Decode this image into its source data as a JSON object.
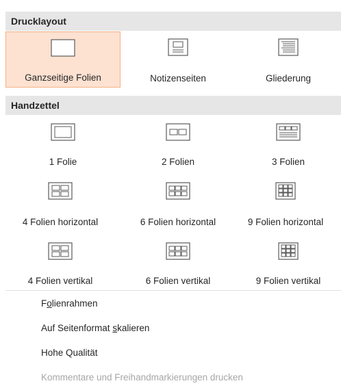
{
  "print_layout": {
    "header": "Drucklayout",
    "items": [
      {
        "label": "Ganzseitige Folien",
        "icon": "full-page-slide-icon",
        "selected": true
      },
      {
        "label": "Notizenseiten",
        "icon": "notes-page-icon",
        "selected": false
      },
      {
        "label": "Gliederung",
        "icon": "outline-icon",
        "selected": false
      }
    ]
  },
  "handouts": {
    "header": "Handzettel",
    "items": [
      {
        "label": "1 Folie",
        "icon": "handout-1-slide-icon"
      },
      {
        "label": "2 Folien",
        "icon": "handout-2-slides-icon"
      },
      {
        "label": "3 Folien",
        "icon": "handout-3-slides-icon"
      },
      {
        "label": "4 Folien horizontal",
        "icon": "handout-4-horizontal-icon"
      },
      {
        "label": "6 Folien horizontal",
        "icon": "handout-6-horizontal-icon"
      },
      {
        "label": "9 Folien horizontal",
        "icon": "handout-9-horizontal-icon"
      },
      {
        "label": "4 Folien vertikal",
        "icon": "handout-4-vertical-icon"
      },
      {
        "label": "6 Folien vertikal",
        "icon": "handout-6-vertical-icon"
      },
      {
        "label": "9 Folien vertikal",
        "icon": "handout-9-vertical-icon"
      }
    ]
  },
  "options": {
    "frame_slides_pre": "F",
    "frame_slides_underline": "o",
    "frame_slides_post": "lienrahmen",
    "scale_pre": "Auf Seitenformat ",
    "scale_underline": "s",
    "scale_post": "kalieren",
    "high_quality": "Hohe Qualität",
    "comments": "Kommentare und Freihandmarkierungen drucken"
  },
  "colors": {
    "selected_background": "#fde1d1",
    "selected_border": "#f4b183",
    "header_background": "#e6e6e6",
    "disabled_text": "#a6a6a6"
  }
}
